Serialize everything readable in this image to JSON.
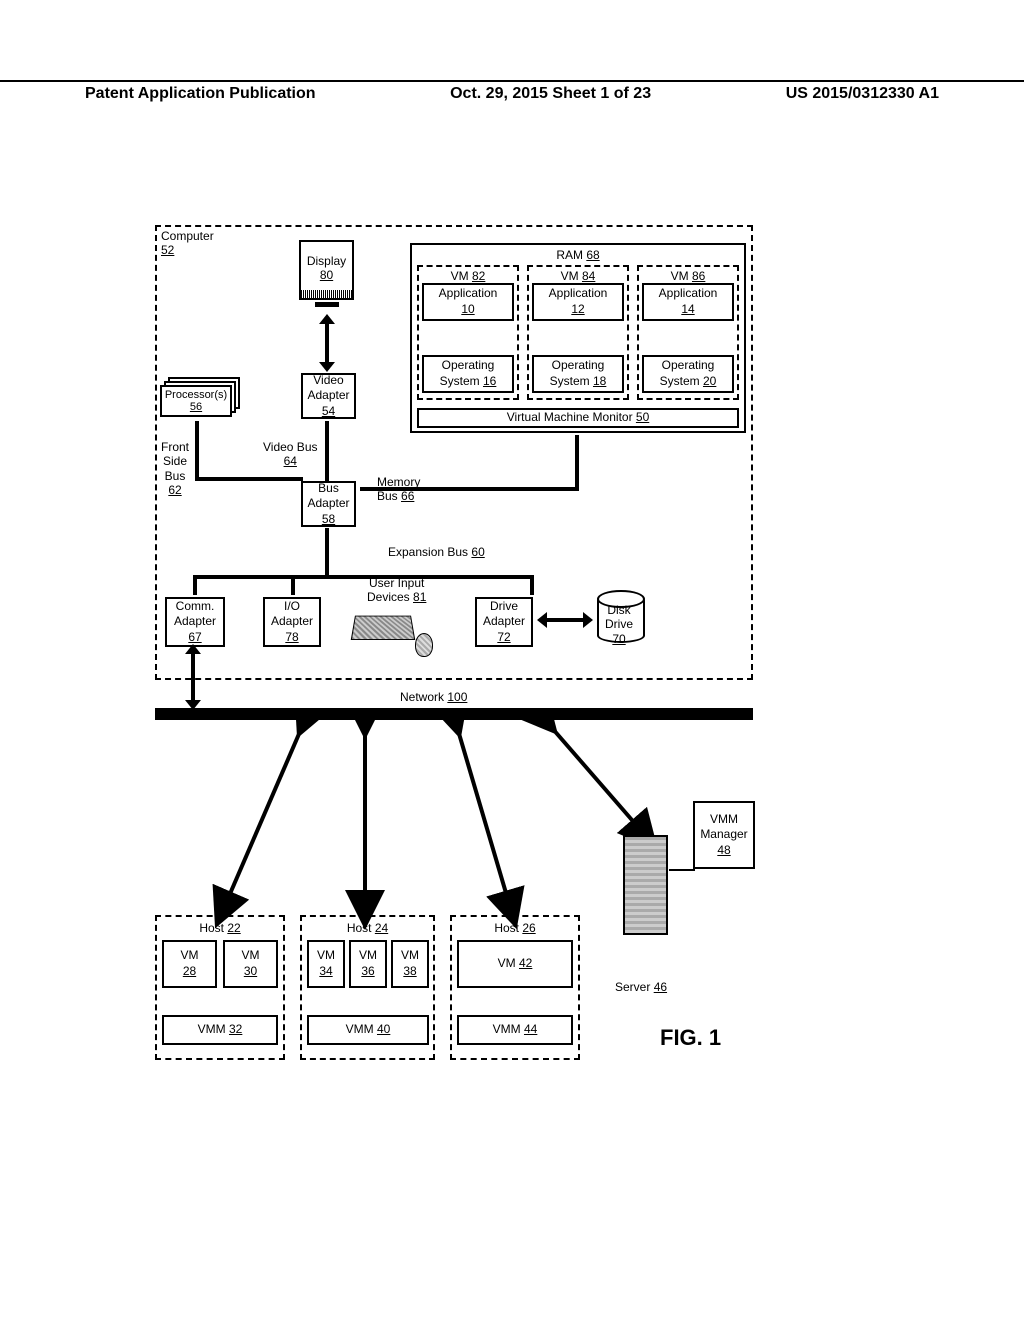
{
  "header": {
    "left": "Patent Application Publication",
    "center": "Oct. 29, 2015  Sheet 1 of 23",
    "right": "US 2015/0312330 A1"
  },
  "figure_label": "FIG. 1",
  "computer": {
    "title": "Computer",
    "ref": "52",
    "display": {
      "label": "Display",
      "ref": "80"
    },
    "processors": {
      "label": "Processor(s)",
      "ref": "56"
    },
    "video_adapter": {
      "label": "Video\nAdapter",
      "ref": "54"
    },
    "front_side_bus": {
      "label": "Front\nSide\nBus",
      "ref": "62"
    },
    "video_bus": {
      "label": "Video Bus",
      "ref": "64"
    },
    "bus_adapter": {
      "label": "Bus\nAdapter",
      "ref": "58"
    },
    "memory_bus": {
      "label": "Memory\nBus ",
      "ref": "66"
    },
    "expansion_bus": {
      "label": "Expansion Bus ",
      "ref": "60"
    },
    "comm_adapter": {
      "label": "Comm.\nAdapter",
      "ref": "67"
    },
    "io_adapter": {
      "label": "I/O\nAdapter",
      "ref": "78"
    },
    "user_input": {
      "label": "User Input\nDevices ",
      "ref": "81"
    },
    "drive_adapter": {
      "label": "Drive\nAdapter",
      "ref": "72"
    },
    "disk_drive": {
      "label": "Disk\nDrive",
      "ref": "70"
    },
    "ram": {
      "label": "RAM ",
      "ref": "68",
      "vm1": {
        "label": "VM ",
        "ref": "82",
        "app": "Application",
        "app_ref": "10",
        "os": "Operating\nSystem ",
        "os_ref": "16"
      },
      "vm2": {
        "label": "VM ",
        "ref": "84",
        "app": "Application",
        "app_ref": "12",
        "os": "Operating\nSystem ",
        "os_ref": "18"
      },
      "vm3": {
        "label": "VM ",
        "ref": "86",
        "app": "Application",
        "app_ref": "14",
        "os": "Operating\nSystem ",
        "os_ref": "20"
      },
      "vmm": {
        "label": "Virtual Machine Monitor ",
        "ref": "50"
      }
    }
  },
  "network": {
    "label": "Network ",
    "ref": "100"
  },
  "hosts": {
    "host1": {
      "label": "Host ",
      "ref": "22",
      "vm1": "VM",
      "vm1_ref": "28",
      "vm2": "VM",
      "vm2_ref": "30",
      "vmm": "VMM ",
      "vmm_ref": "32"
    },
    "host2": {
      "label": "Host ",
      "ref": "24",
      "vm1": "VM",
      "vm1_ref": "34",
      "vm2": "VM",
      "vm2_ref": "36",
      "vm3": "VM",
      "vm3_ref": "38",
      "vmm": "VMM ",
      "vmm_ref": "40"
    },
    "host3": {
      "label": "Host ",
      "ref": "26",
      "vm": "VM ",
      "vm_ref": "42",
      "vmm": "VMM ",
      "vmm_ref": "44"
    }
  },
  "server": {
    "label": "Server ",
    "ref": "46"
  },
  "vmm_manager": {
    "label": "VMM\nManager",
    "ref": "48"
  }
}
